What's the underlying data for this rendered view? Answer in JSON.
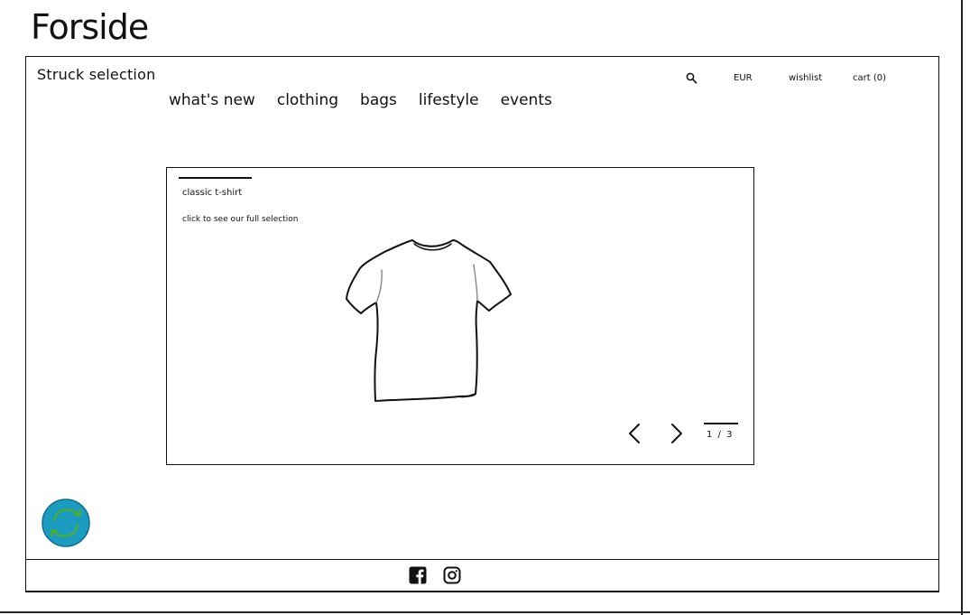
{
  "page": {
    "heading": "Forside"
  },
  "header": {
    "brand": "Struck selection",
    "nav": [
      {
        "label": "what's new"
      },
      {
        "label": "clothing"
      },
      {
        "label": "bags"
      },
      {
        "label": "lifestyle"
      },
      {
        "label": "events"
      }
    ],
    "utility": {
      "search_icon": "search-icon",
      "currency": "EUR",
      "wishlist": "wishlist",
      "cart": "cart (0)"
    }
  },
  "hero": {
    "title": "classic t-shirt",
    "caption": "click to see our full selection",
    "image_icon": "tshirt-illustration",
    "prev_icon": "chevron-left-icon",
    "next_icon": "chevron-right-icon",
    "counter": "1 / 3"
  },
  "badge": {
    "icon": "sync-arrows-icon",
    "fill_color": "#1B9BC0",
    "arrow_color": "#4CAF30"
  },
  "footer": {
    "social": [
      {
        "icon": "facebook-icon"
      },
      {
        "icon": "instagram-icon"
      }
    ]
  }
}
